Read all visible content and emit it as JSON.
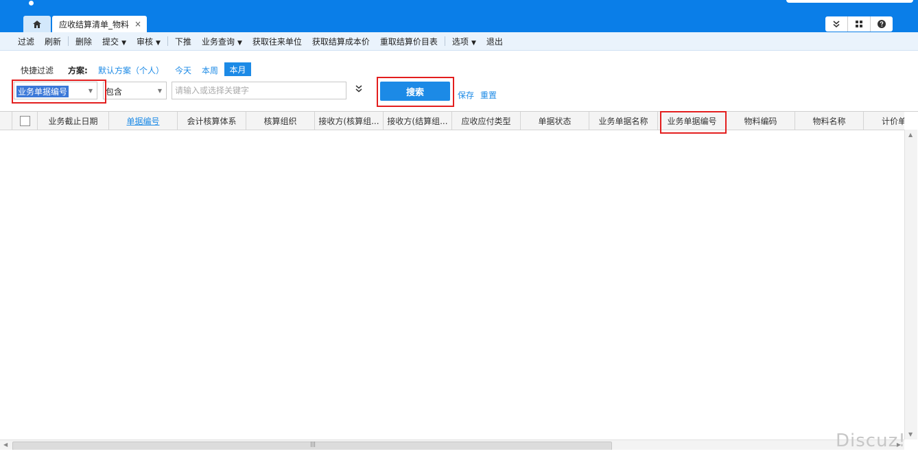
{
  "header": {
    "tabs": [
      {
        "label": "应收结算清单_物料",
        "close": "×"
      }
    ]
  },
  "toolbar": {
    "items": [
      "过滤",
      "刷新",
      "删除",
      "提交",
      "审核",
      "下推",
      "业务查询",
      "获取往来单位",
      "获取结算成本价",
      "重取结算价目表",
      "选项",
      "退出"
    ]
  },
  "quick_filter": {
    "label": "快捷过滤",
    "scheme_label": "方案:",
    "default_scheme": "默认方案（个人）",
    "today": "今天",
    "this_week": "本周",
    "this_month": "本月",
    "field": "业务单据编号",
    "operator": "包含",
    "keyword_placeholder": "请输入或选择关键字",
    "search": "搜索",
    "save": "保存",
    "reset": "重置"
  },
  "grid": {
    "columns": [
      "业务截止日期",
      "单据编号",
      "会计核算体系",
      "核算组织",
      "接收方(核算组...",
      "接收方(结算组...",
      "应收应付类型",
      "单据状态",
      "业务单据名称",
      "业务单据编号",
      "物料编码",
      "物料名称",
      "计价单"
    ]
  },
  "watermark": "Discuz!"
}
